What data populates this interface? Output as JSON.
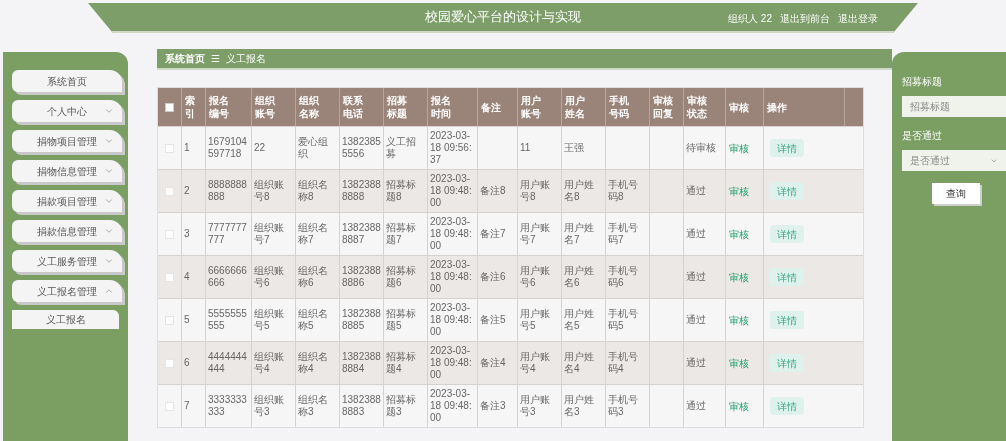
{
  "header": {
    "title": "校园爱心平台的设计与实现",
    "user": "组织人 22",
    "links": [
      "退出到前台",
      "退出登录"
    ]
  },
  "breadcrumb": {
    "home": "系统首页",
    "separator": "☰",
    "current": "义工报名"
  },
  "sidebar": {
    "items": [
      {
        "label": "系统首页"
      },
      {
        "label": "个人中心",
        "expanded": false
      },
      {
        "label": "捐物项目管理",
        "expanded": false
      },
      {
        "label": "捐物信息管理",
        "expanded": false
      },
      {
        "label": "捐款项目管理",
        "expanded": false
      },
      {
        "label": "捐款信息管理",
        "expanded": false
      },
      {
        "label": "义工服务管理",
        "expanded": false
      },
      {
        "label": "义工报名管理",
        "expanded": true,
        "children": [
          {
            "label": "义工报名"
          }
        ]
      }
    ]
  },
  "table": {
    "select_all": {
      "checked": false
    },
    "columns": [
      "索引",
      "报名编号",
      "组织账号",
      "组织名称",
      "联系电话",
      "招募标题",
      "报名时间",
      "备注",
      "用户账号",
      "用户姓名",
      "手机号码",
      "审核回复",
      "审核状态",
      "审核",
      "操作"
    ],
    "rows": [
      {
        "checked": false,
        "cells": [
          "1",
          "1679104597718",
          "22",
          "爱心组织",
          "13823855556",
          "义工招募",
          "2023-03-18 09:56:37",
          "",
          "11",
          "王强",
          "",
          "",
          "待审核"
        ],
        "action_link": "审核",
        "button": "详情"
      },
      {
        "checked": false,
        "cells": [
          "2",
          "8888888888",
          "组织账号8",
          "组织名称8",
          "13823888888",
          "招募标题8",
          "2023-03-18 09:48:00",
          "备注8",
          "用户账号8",
          "用户姓名8",
          "手机号码8",
          "",
          "通过"
        ],
        "action_link": "审核",
        "button": "详情"
      },
      {
        "checked": false,
        "cells": [
          "3",
          "7777777777",
          "组织账号7",
          "组织名称7",
          "13823888887",
          "招募标题7",
          "2023-03-18 09:48:00",
          "备注7",
          "用户账号7",
          "用户姓名7",
          "手机号码7",
          "",
          "通过"
        ],
        "action_link": "审核",
        "button": "详情"
      },
      {
        "checked": false,
        "cells": [
          "4",
          "6666666666",
          "组织账号6",
          "组织名称6",
          "13823888886",
          "招募标题6",
          "2023-03-18 09:48:00",
          "备注6",
          "用户账号6",
          "用户姓名6",
          "手机号码6",
          "",
          "通过"
        ],
        "action_link": "审核",
        "button": "详情"
      },
      {
        "checked": false,
        "cells": [
          "5",
          "5555555555",
          "组织账号5",
          "组织名称5",
          "13823888885",
          "招募标题5",
          "2023-03-18 09:48:00",
          "备注5",
          "用户账号5",
          "用户姓名5",
          "手机号码5",
          "",
          "通过"
        ],
        "action_link": "审核",
        "button": "详情"
      },
      {
        "checked": false,
        "cells": [
          "6",
          "4444444444",
          "组织账号4",
          "组织名称4",
          "13823888884",
          "招募标题4",
          "2023-03-18 09:48:00",
          "备注4",
          "用户账号4",
          "用户姓名4",
          "手机号码4",
          "",
          "通过"
        ],
        "action_link": "审核",
        "button": "详情"
      },
      {
        "checked": false,
        "cells": [
          "7",
          "3333333333",
          "组织账号3",
          "组织名称3",
          "13823888883",
          "招募标题3",
          "2023-03-18 09:48:00",
          "备注3",
          "用户账号3",
          "用户姓名3",
          "手机号码3",
          "",
          "通过"
        ],
        "action_link": "审核",
        "button": "详情"
      }
    ]
  },
  "search": {
    "fields": [
      {
        "kind": "text",
        "label": "招募标题",
        "placeholder": "招募标题"
      },
      {
        "kind": "select",
        "label": "是否通过",
        "placeholder": "是否通过"
      }
    ],
    "button": "查询"
  }
}
